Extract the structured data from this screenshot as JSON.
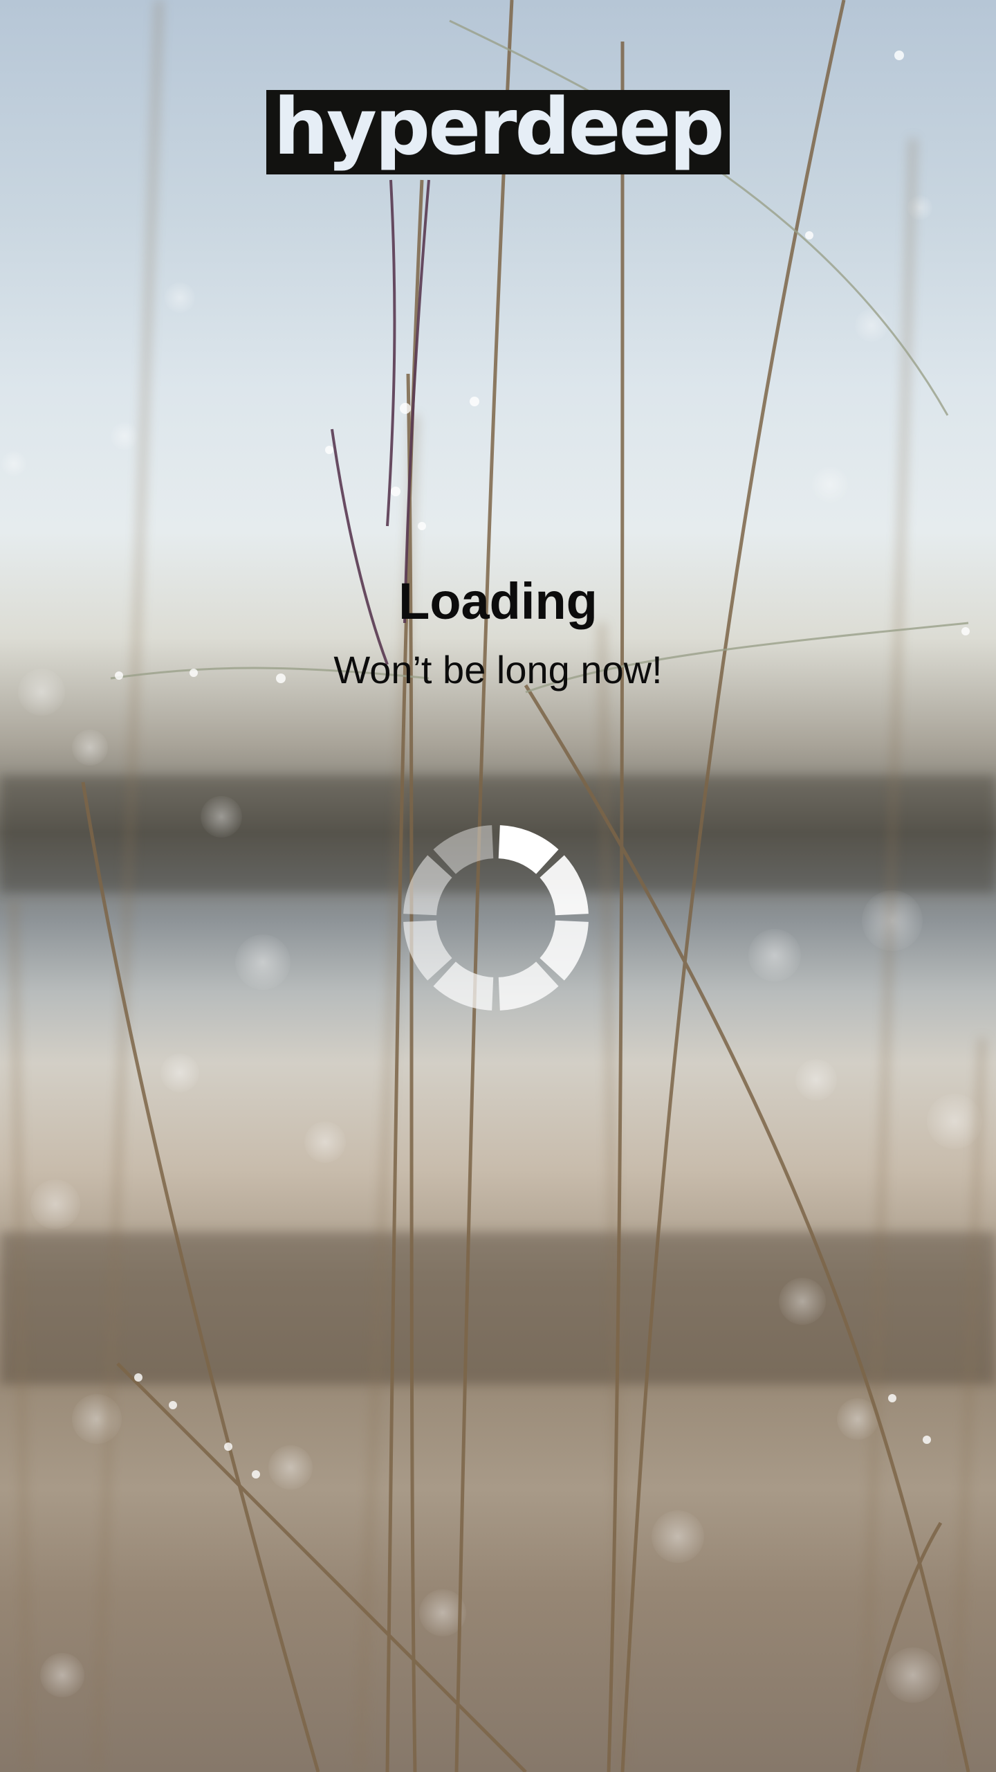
{
  "brand": {
    "logo_text": "hyperdeep"
  },
  "loading": {
    "title": "Loading",
    "subtitle": "Won’t be long now!"
  },
  "spinner": {
    "icon": "spinner-icon",
    "segments": 8,
    "color": "#ffffff"
  },
  "background": {
    "description_icon": "grass-dewdrops-photo"
  }
}
